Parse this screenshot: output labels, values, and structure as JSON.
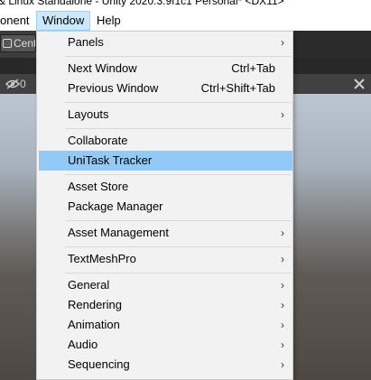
{
  "window": {
    "title": "& Linux Standalone - Unity 2020.3.9f1c1 Personal* <DX11>"
  },
  "menubar": {
    "items": [
      {
        "label": "onent"
      },
      {
        "label": "Window"
      },
      {
        "label": "Help"
      }
    ]
  },
  "toolbar": {
    "center_label": "Cent"
  },
  "scene_header": {
    "visibility_count": "0",
    "tools_icon": "tools-icon"
  },
  "colors": {
    "highlight": "#91c9f7",
    "menu_bg": "#f2f2f2",
    "active_menubar": "#cce8ff"
  },
  "window_menu": {
    "items": [
      {
        "label": "Panels",
        "shortcut": "",
        "submenu": true
      },
      {
        "label": "Next Window",
        "shortcut": "Ctrl+Tab",
        "submenu": false
      },
      {
        "label": "Previous Window",
        "shortcut": "Ctrl+Shift+Tab",
        "submenu": false
      },
      {
        "label": "Layouts",
        "shortcut": "",
        "submenu": true
      },
      {
        "label": "Collaborate",
        "shortcut": "",
        "submenu": false
      },
      {
        "label": "UniTask Tracker",
        "shortcut": "",
        "submenu": false,
        "highlighted": true
      },
      {
        "label": "Asset Store",
        "shortcut": "",
        "submenu": false
      },
      {
        "label": "Package Manager",
        "shortcut": "",
        "submenu": false
      },
      {
        "label": "Asset Management",
        "shortcut": "",
        "submenu": true
      },
      {
        "label": "TextMeshPro",
        "shortcut": "",
        "submenu": true
      },
      {
        "label": "General",
        "shortcut": "",
        "submenu": true
      },
      {
        "label": "Rendering",
        "shortcut": "",
        "submenu": true
      },
      {
        "label": "Animation",
        "shortcut": "",
        "submenu": true
      },
      {
        "label": "Audio",
        "shortcut": "",
        "submenu": true
      },
      {
        "label": "Sequencing",
        "shortcut": "",
        "submenu": true
      }
    ],
    "submenu_arrow": "›"
  }
}
